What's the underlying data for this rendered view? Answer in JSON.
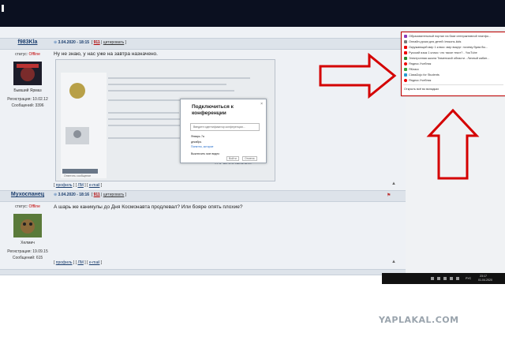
{
  "posts": [
    {
      "nick": "f983Kla",
      "status_label": "статус:",
      "status": "Offline",
      "rank": "Бывший Ярмаз",
      "registration": "Регистрация: 10.02.12",
      "messages": "Сообщений: 3396",
      "date": "3.04.2020 - 18:15",
      "num": "911",
      "quote": "цитировать",
      "text": "Ну не знаю, у нас уже на завтра назначено."
    },
    {
      "nick": "Мухоспанец",
      "status_label": "статус:",
      "status": "Offline",
      "rank": "Хелмич",
      "registration": "Регистрация: 19.09.15",
      "messages": "Сообщений: 615",
      "date": "3.04.2020 - 18:16",
      "num": "911",
      "quote": "цитировать",
      "text": "А шарь же каникулы до Дня Космонавта продлевал? Или бояре опять плохие?"
    }
  ],
  "post_footer": {
    "profile": "профиль",
    "pm": "ЛМ",
    "email": "e-mail"
  },
  "embedded": {
    "dialog_title": "Подключиться к конференции",
    "dialog_input": "Введите идентификатор конференции...",
    "row1": "Январь 7а",
    "row2": "декабрь",
    "link": "Понятно, которое",
    "check": "Выключить мое видео",
    "cancel": "Отмена",
    "join": "Войти",
    "watermark_small": "YAPLAKAL.COM",
    "inner_note": "Ответить сообщение"
  },
  "menu_items": [
    "Образовательный портал на базе интерактивной платфо...",
    "Онлайн-уроки для детей: lessons-kids",
    "Окружающий мир 1 класс: мир вокруг: почему бума бы...",
    "Русский язык 1 класс: что такое текст? - YouTube",
    "Электронная школа Тюменской области - Личный кабин...",
    "Яндекс.Учебник",
    "ЯКласс",
    "ClassDojo for Students",
    "Яндекс.Учебник",
    "Открыть всё во вкладках"
  ],
  "taskbar": {
    "lang": "РУС",
    "time": "23:17",
    "date": "01.04.2020"
  },
  "watermark": "YAPLAKAL.COM",
  "colors": {
    "arrow": "#d40000",
    "offline": "#c00000",
    "link": "#1a3d6d"
  }
}
